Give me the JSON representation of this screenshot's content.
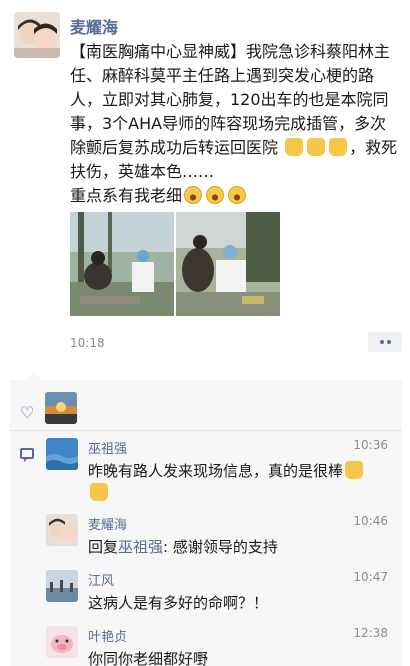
{
  "post": {
    "author": "麦耀海",
    "text_main": "【南医胸痛中心显神威】我院急诊科蔡阳林主任、麻醉科莫平主任路上遇到突发心梗的路人，立即对其心肺复，120出车的也是本院同事，3个AHA导师的阵容现场完成插管，多次除颤后复苏成功后转运回医院",
    "text_tail": "，救死扶伤，英雄本色……",
    "text_line2": "重点系有我老细",
    "time": "10:18"
  },
  "comments": [
    {
      "name": "巫祖强",
      "time": "10:36",
      "text": "昨晚有路人发来现场信息，真的是很棒"
    },
    {
      "name": "麦耀海",
      "time": "10:46",
      "reply_prefix": "回复",
      "reply_to": "巫祖强",
      "text": ": 感谢领导的支持"
    },
    {
      "name": "江风",
      "time": "10:47",
      "text": "这病人是有多好的命啊？！"
    },
    {
      "name": "叶艳贞",
      "time": "12:38",
      "text": "你同你老细都好嘢"
    }
  ],
  "icons": {
    "like": "heart-icon",
    "comment": "comment-icon",
    "more": "more-dots-icon"
  },
  "colors": {
    "link": "#576b95",
    "panel": "#f7f7f7",
    "timestamp": "#8c8c8c"
  }
}
